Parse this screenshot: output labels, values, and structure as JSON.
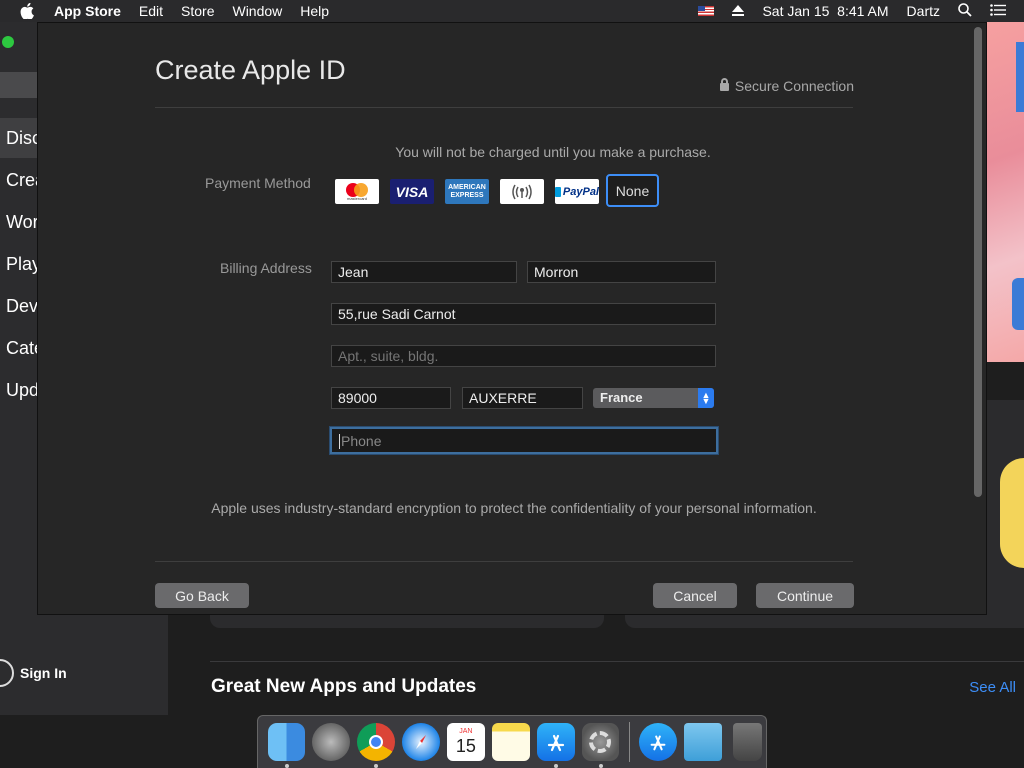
{
  "menubar": {
    "app_name": "App Store",
    "items": [
      "Edit",
      "Store",
      "Window",
      "Help"
    ],
    "datetime": "Sat Jan 15  8:41 AM",
    "user": "Dartz"
  },
  "sidebar": {
    "items": [
      "Disc",
      "Crea",
      "Wor",
      "Play",
      "Dev",
      "Cate",
      "Upd"
    ],
    "sign_in": "Sign In"
  },
  "main": {
    "section_title": "Great New Apps and Updates",
    "see_all": "See All"
  },
  "dialog": {
    "title": "Create Apple ID",
    "secure_label": "Secure Connection",
    "charge_note": "You will not be charged until you make a purchase.",
    "payment_label": "Payment Method",
    "payment_methods": {
      "mastercard": "mastercard",
      "visa": "VISA",
      "amex_top": "AMERICAN",
      "amex_bottom": "EXPRESS",
      "paypal": "PayPal",
      "none": "None"
    },
    "billing_label": "Billing Address",
    "first_name": "Jean",
    "last_name": "Morron",
    "street": "55,rue Sadi Carnot",
    "apt_placeholder": "Apt., suite, bldg.",
    "postcode": "89000",
    "city": "AUXERRE",
    "country": "France",
    "phone_placeholder": "Phone",
    "encryption_note": "Apple uses industry-standard encryption to protect the confidentiality of your personal information.",
    "go_back": "Go Back",
    "cancel": "Cancel",
    "continue": "Continue"
  },
  "dock": {
    "calendar_month": "JAN",
    "calendar_day": "15"
  }
}
